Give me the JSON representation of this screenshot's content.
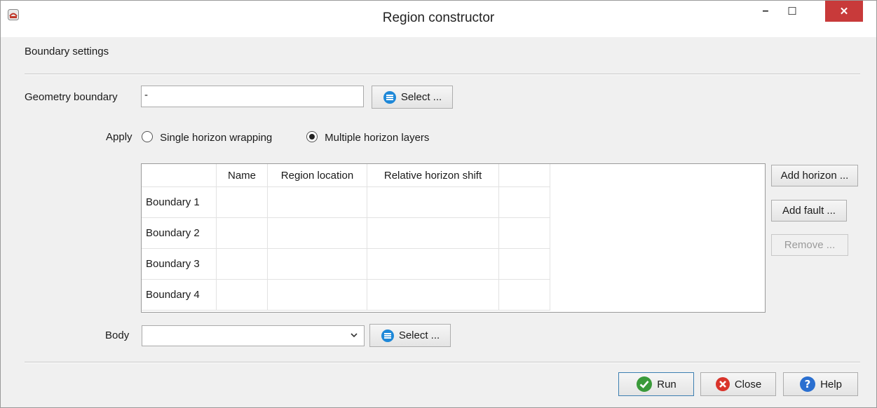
{
  "window": {
    "title": "Region constructor",
    "icon": "app-icon",
    "controls": {
      "minimize": "–",
      "maximize": "☐",
      "close": "✕"
    }
  },
  "section": {
    "title": "Boundary settings"
  },
  "geometry": {
    "label": "Geometry boundary",
    "value": "-",
    "select_label": "Select ..."
  },
  "apply": {
    "label": "Apply",
    "options": [
      {
        "label": "Single horizon wrapping",
        "selected": false
      },
      {
        "label": "Multiple horizon layers",
        "selected": true
      }
    ]
  },
  "table": {
    "columns": [
      "",
      "Name",
      "Region location",
      "Relative horizon shift",
      ""
    ],
    "rows": [
      {
        "label": "Boundary 1",
        "cells": [
          "",
          "",
          "",
          ""
        ]
      },
      {
        "label": "Boundary 2",
        "cells": [
          "",
          "",
          "",
          ""
        ]
      },
      {
        "label": "Boundary 3",
        "cells": [
          "",
          "",
          "",
          ""
        ]
      },
      {
        "label": "Boundary 4",
        "cells": [
          "",
          "",
          "",
          ""
        ]
      }
    ]
  },
  "side_buttons": {
    "add_horizon": "Add horizon ...",
    "add_fault": "Add fault ...",
    "remove": "Remove ..."
  },
  "body": {
    "label": "Body",
    "value": "",
    "select_label": "Select ..."
  },
  "footer": {
    "run": "Run",
    "close": "Close",
    "help": "Help"
  },
  "colors": {
    "close_button": "#c83a3a",
    "select_icon": "#1e88d8",
    "run_icon": "#3a9a3a",
    "close_icon": "#d9342b",
    "help_icon": "#2a6fd0"
  }
}
